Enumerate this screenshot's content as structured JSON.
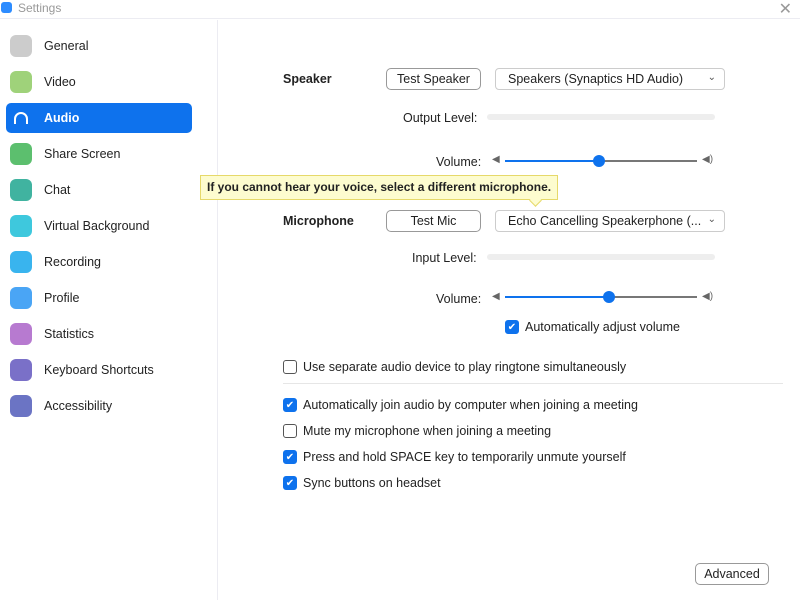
{
  "window": {
    "title": "Settings",
    "close_icon": "close-icon"
  },
  "sidebar": {
    "items": [
      {
        "label": "General",
        "icon": "gear-icon",
        "color": "#cccccc"
      },
      {
        "label": "Video",
        "icon": "video-camera-icon",
        "color": "#9fd27a"
      },
      {
        "label": "Audio",
        "icon": "headphones-icon",
        "color": "#0e72ed",
        "active": true
      },
      {
        "label": "Share Screen",
        "icon": "share-screen-icon",
        "color": "#5cbf6e"
      },
      {
        "label": "Chat",
        "icon": "chat-bubble-icon",
        "color": "#40b3a0"
      },
      {
        "label": "Virtual Background",
        "icon": "virtual-background-icon",
        "color": "#3ec8dd"
      },
      {
        "label": "Recording",
        "icon": "record-icon",
        "color": "#39b4ee"
      },
      {
        "label": "Profile",
        "icon": "person-icon",
        "color": "#4aa5f5"
      },
      {
        "label": "Statistics",
        "icon": "bar-chart-icon",
        "color": "#b77ad0"
      },
      {
        "label": "Keyboard Shortcuts",
        "icon": "keyboard-icon",
        "color": "#7a70c8"
      },
      {
        "label": "Accessibility",
        "icon": "accessibility-icon",
        "color": "#6b74c4"
      }
    ]
  },
  "audio": {
    "speaker": {
      "label": "Speaker",
      "test_button": "Test Speaker",
      "device": "Speakers (Synaptics HD Audio)",
      "output_level_label": "Output Level:",
      "volume_label": "Volume:",
      "volume_percent": 49
    },
    "tooltip": "If you cannot hear your voice, select a different microphone.",
    "microphone": {
      "label": "Microphone",
      "test_button": "Test Mic",
      "device": "Echo Cancelling Speakerphone (...",
      "input_level_label": "Input Level:",
      "volume_label": "Volume:",
      "volume_percent": 54,
      "auto_adjust": {
        "label": "Automatically adjust volume",
        "checked": true
      }
    },
    "options": [
      {
        "label": "Use separate audio device to play ringtone simultaneously",
        "checked": false
      },
      {
        "label": "Automatically join audio by computer when joining a meeting",
        "checked": true
      },
      {
        "label": "Mute my microphone when joining a meeting",
        "checked": false
      },
      {
        "label": "Press and hold SPACE key to temporarily unmute yourself",
        "checked": true
      },
      {
        "label": "Sync buttons on headset",
        "checked": true
      }
    ],
    "advanced_button": "Advanced"
  },
  "colors": {
    "accent": "#0e72ed"
  }
}
